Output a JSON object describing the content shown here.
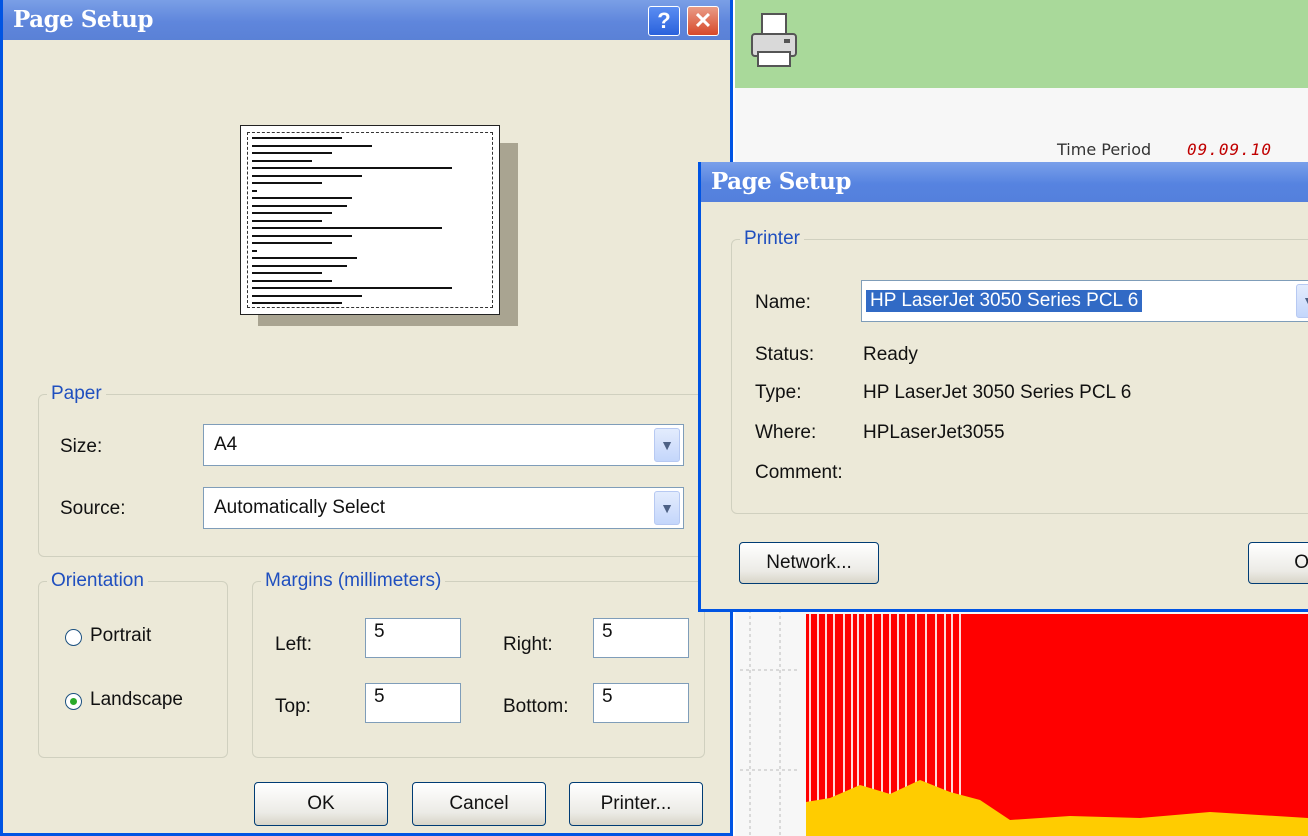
{
  "background_app": {
    "time_period_label": "Time Period",
    "time_period_value": "09.09.10",
    "chart_colors": {
      "fill": "#ff0000",
      "low": "#ffcc00",
      "lines": "#ffd9d9"
    }
  },
  "page_setup": {
    "title": "Page Setup",
    "help_label": "?",
    "close_label": "✕",
    "paper": {
      "legend": "Paper",
      "size_label": "Size:",
      "size_value": "A4",
      "source_label": "Source:",
      "source_value": "Automatically Select"
    },
    "orientation": {
      "legend": "Orientation",
      "portrait_label": "Portrait",
      "landscape_label": "Landscape",
      "selected": "Landscape"
    },
    "margins": {
      "legend": "Margins (millimeters)",
      "left_label": "Left:",
      "left_value": "5",
      "right_label": "Right:",
      "right_value": "5",
      "top_label": "Top:",
      "top_value": "5",
      "bottom_label": "Bottom:",
      "bottom_value": "5"
    },
    "buttons": {
      "ok": "OK",
      "cancel": "Cancel",
      "printer": "Printer..."
    }
  },
  "printer_dialog": {
    "title": "Page Setup",
    "group_legend": "Printer",
    "name_label": "Name:",
    "name_value": "HP LaserJet 3050 Series PCL 6",
    "status_label": "Status:",
    "status_value": "Ready",
    "type_label": "Type:",
    "type_value": "HP LaserJet 3050 Series PCL 6",
    "where_label": "Where:",
    "where_value": "HPLaserJet3055",
    "comment_label": "Comment:",
    "comment_value": "",
    "network_button": "Network...",
    "ok_button_partial": "O"
  },
  "colors": {
    "title_bar": "#5f86dc",
    "dialog_bg": "#ece9d8",
    "group_legend": "#1f4fbf",
    "selection": "#316ac5"
  }
}
